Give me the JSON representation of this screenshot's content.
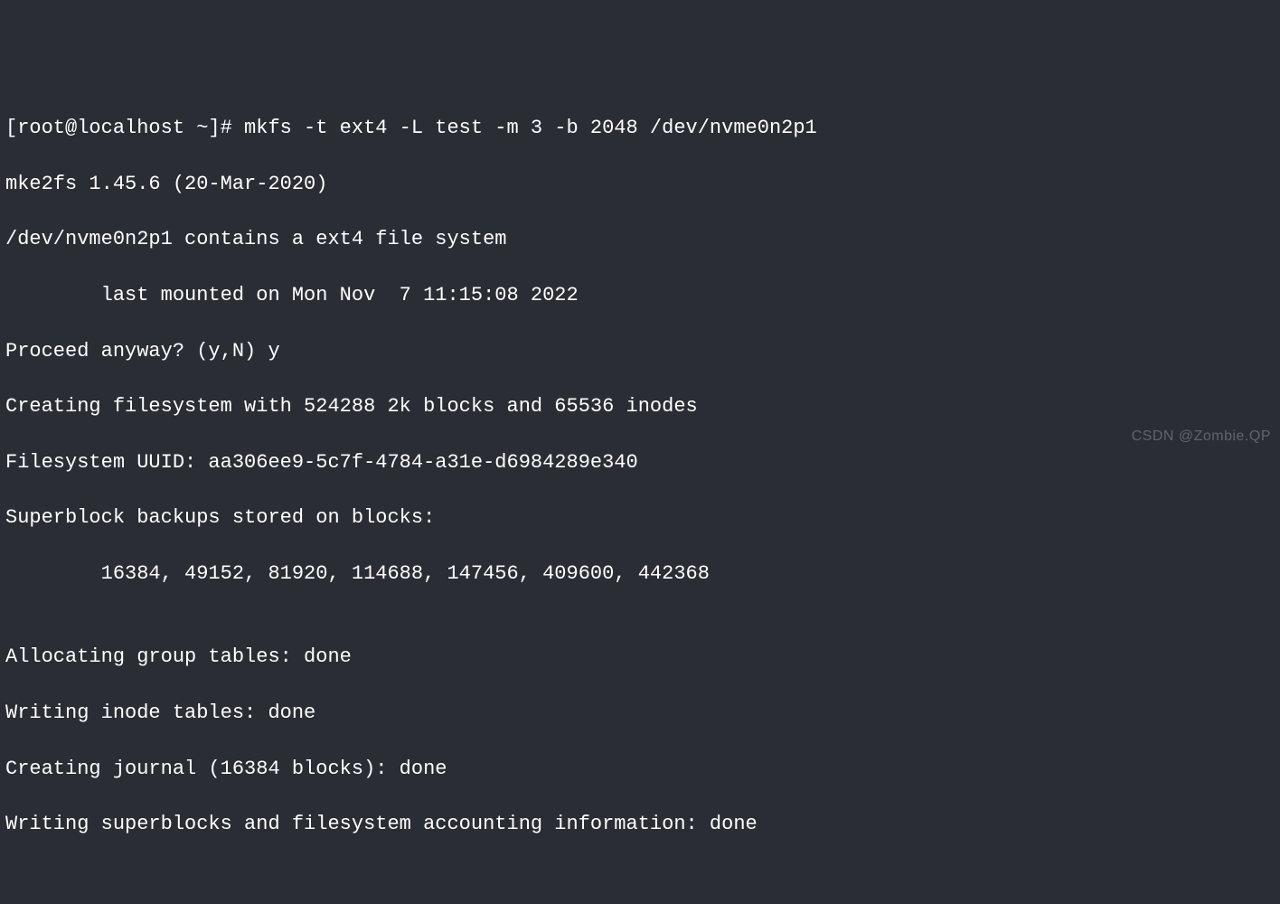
{
  "terminal": {
    "lines": {
      "l1": "[root@localhost ~]# mkfs -t ext4 -L test -m 3 -b 2048 /dev/nvme0n2p1",
      "l2": "mke2fs 1.45.6 (20-Mar-2020)",
      "l3": "/dev/nvme0n2p1 contains a ext4 file system",
      "l4": "        last mounted on Mon Nov  7 11:15:08 2022",
      "l5": "Proceed anyway? (y,N) y",
      "l6": "Creating filesystem with 524288 2k blocks and 65536 inodes",
      "l7": "Filesystem UUID: aa306ee9-5c7f-4784-a31e-d6984289e340",
      "l8": "Superblock backups stored on blocks: ",
      "l9": "        16384, 49152, 81920, 114688, 147456, 409600, 442368",
      "l10": "",
      "l11": "Allocating group tables: done",
      "l12": "Writing inode tables: done",
      "l13": "Creating journal (16384 blocks): done",
      "l14": "Writing superblocks and filesystem accounting information: done"
    }
  },
  "watermark": "CSDN @Zombie.QP"
}
